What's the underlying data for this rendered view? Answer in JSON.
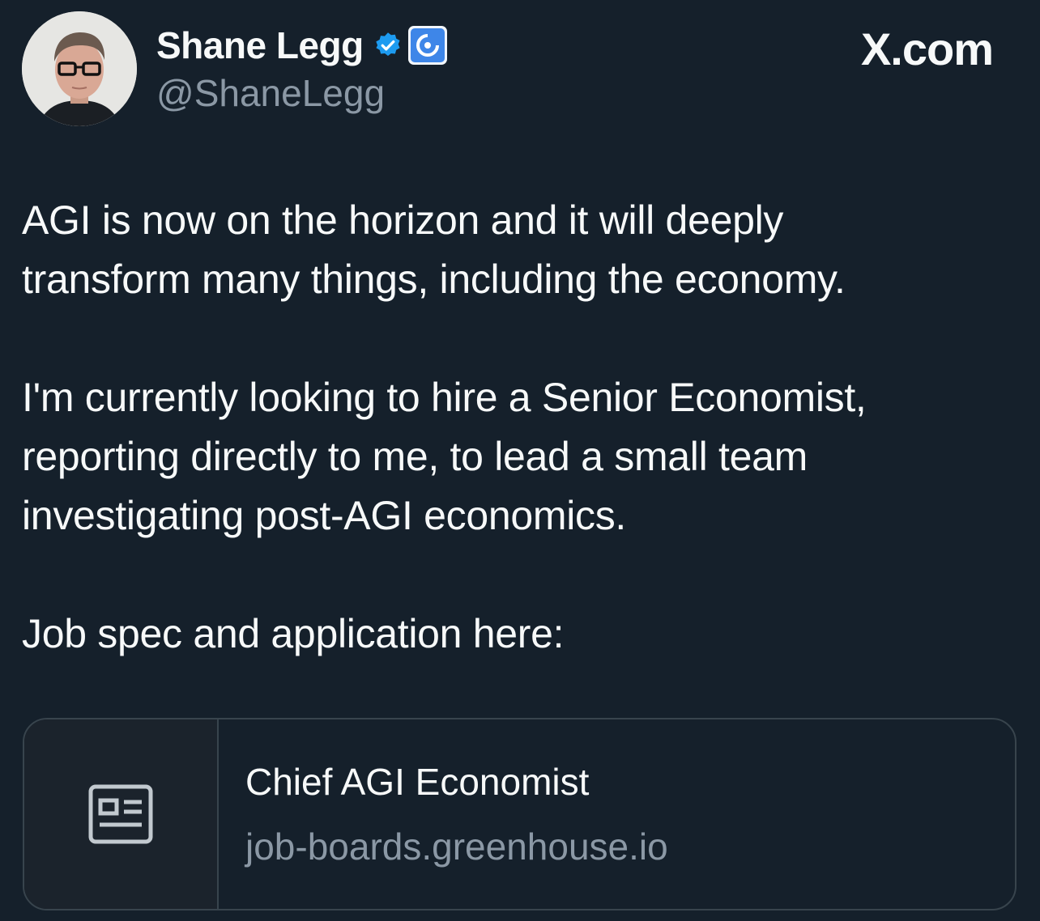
{
  "author": {
    "display_name": "Shane Legg",
    "handle": "@ShaneLegg",
    "verified_icon": "verified-badge-icon",
    "affiliation_icon": "affiliation-logo-icon"
  },
  "brand": "X.com",
  "tweet": {
    "paragraph_1": [
      "AGI is now on the horizon and it will deeply",
      "transform many things, including the economy."
    ],
    "paragraph_2": [
      "I'm currently looking to hire a Senior Economist,",
      "reporting directly to me, to lead a small team",
      "investigating post-AGI economics."
    ],
    "paragraph_3": [
      "Job spec and application here:"
    ]
  },
  "link_card": {
    "icon": "article-icon",
    "title": "Chief AGI Economist",
    "domain": "job-boards.greenhouse.io"
  },
  "colors": {
    "background": "#15202b",
    "text_primary": "#f7f9f9",
    "text_secondary": "#8b98a5",
    "verified_blue": "#1d9bf0",
    "border": "#38444d"
  }
}
